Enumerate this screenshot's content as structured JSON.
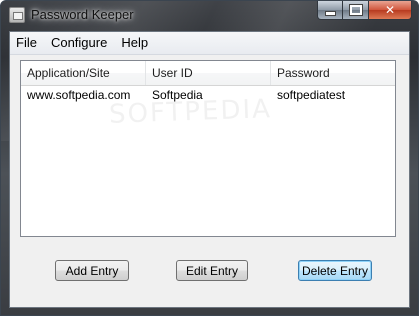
{
  "window": {
    "title": "Password Keeper",
    "close_glyph": "✕"
  },
  "menu": [
    "File",
    "Configure",
    "Help"
  ],
  "list": {
    "columns": [
      "Application/Site",
      "User ID",
      "Password"
    ],
    "rows": [
      [
        "www.softpedia.com",
        "Softpedia",
        "softpediatest"
      ]
    ]
  },
  "watermark": "SOFTPEDIA",
  "buttons": {
    "add": "Add Entry",
    "edit": "Edit Entry",
    "delete": "Delete Entry"
  },
  "colors": {
    "frame": "#3a3d42",
    "close_button": "#c94a2e",
    "default_button_border": "#3c7fb1"
  }
}
